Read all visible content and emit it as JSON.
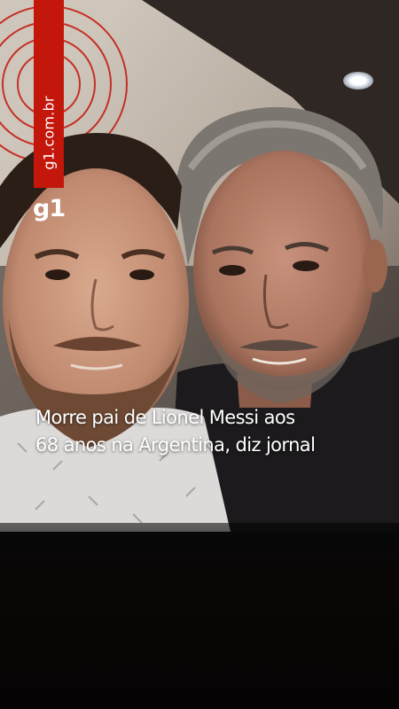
{
  "brand": {
    "url": "g1.com.br",
    "logo": "g1",
    "accent_color": "#c4170c"
  },
  "headline": {
    "line1": "Morre pai de Lionel Messi aos",
    "line2": "68 anos na Argentina, diz jornal"
  }
}
